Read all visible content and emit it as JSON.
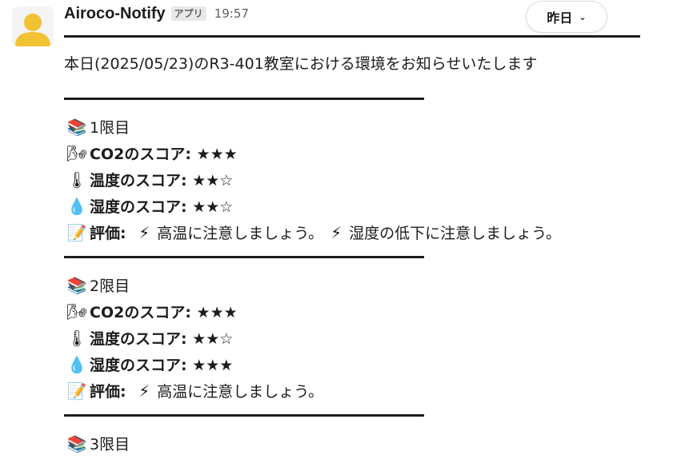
{
  "message": {
    "sender": "Airoco-Notify",
    "badge": "アプリ",
    "time": "19:57",
    "date_pill": "昨日",
    "intro": "本日(2025/05/23)のR3-401教室における環境をお知らせいたします",
    "period1": {
      "title": "1限目",
      "co2_label": "CO2のスコア",
      "co2_stars": "★★★",
      "temp_label": "温度のスコア",
      "temp_stars": "★★☆",
      "hum_label": "湿度のスコア",
      "hum_stars": "★★☆",
      "eval_label": "評価",
      "eval_text1": "高温に注意しましょう。",
      "eval_text2": "湿度の低下に注意しましょう。"
    },
    "period2": {
      "title": "2限目",
      "co2_label": "CO2のスコア",
      "co2_stars": "★★★",
      "temp_label": "温度のスコア",
      "temp_stars": "★★☆",
      "hum_label": "湿度のスコア",
      "hum_stars": "★★★",
      "eval_label": "評価",
      "eval_text1": "高温に注意しましょう。"
    },
    "period3": {
      "title": "3限目"
    }
  },
  "icons": {
    "books": "books-icon",
    "wind": "wind-icon",
    "thermometer": "thermometer-icon",
    "droplet": "droplet-icon",
    "memo": "memo-icon",
    "lightning": "lightning-icon"
  }
}
